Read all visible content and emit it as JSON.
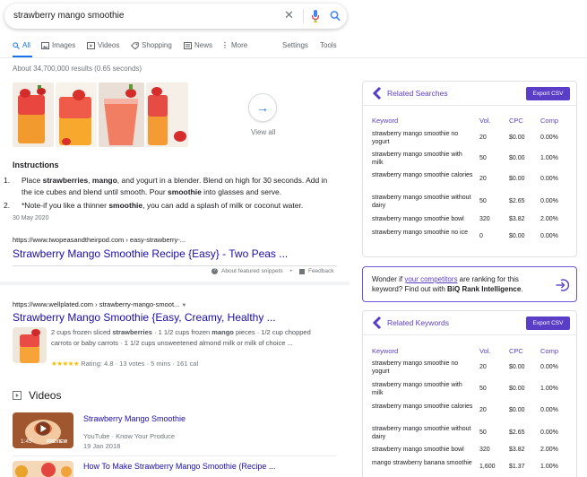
{
  "search": {
    "query": "strawberry mango smoothie",
    "clear_icon": "close-icon",
    "voice_icon": "mic-icon",
    "search_icon": "search-icon"
  },
  "tabs": [
    {
      "label": "All",
      "icon": "search-icon",
      "active": true
    },
    {
      "label": "Images",
      "icon": "image-icon"
    },
    {
      "label": "Videos",
      "icon": "video-icon"
    },
    {
      "label": "Shopping",
      "icon": "tag-icon"
    },
    {
      "label": "News",
      "icon": "news-icon"
    },
    {
      "label": "More",
      "icon": "dots-icon"
    },
    {
      "label": "Settings"
    },
    {
      "label": "Tools"
    }
  ],
  "stats": "About 34,700,000 results (0.65 seconds)",
  "images": {
    "view_all": "View all"
  },
  "featured": {
    "heading": "Instructions",
    "steps": [
      {
        "n": "1.",
        "parts": [
          "Place ",
          "strawberries",
          ", ",
          "mango",
          ", and yogurt in a blender. Blend on high for 30 seconds. Add in the ice cubes and blend until smooth. Pour ",
          "smoothie",
          " into glasses and serve."
        ]
      },
      {
        "n": "2.",
        "parts": [
          "*Note-if you like a thinner ",
          "smoothie",
          ", you can add a splash of milk or coconut water."
        ]
      }
    ],
    "date": "30 May 2020",
    "url": "https://www.twopeasandtheirpod.com › easy-strawberry-...",
    "title": "Strawberry Mango Smoothie Recipe {Easy} - Two Peas ...",
    "about": "About featured snippets",
    "dot": "•",
    "feedback": "Feedback"
  },
  "result2": {
    "url": "https://www.wellplated.com › strawberry-mango-smoot...",
    "title": "Strawberry Mango Smoothie {Easy, Creamy, Healthy ...",
    "snippet_parts": [
      "2 cups frozen sliced ",
      "strawberries",
      " · 1 1/2 cups frozen ",
      "mango",
      " pieces · 1/2 cup chopped carrots or baby carrots · 1 1/2 cups unsweetened almond milk or milk of choice ..."
    ],
    "stars": "★★★★★",
    "rating_text": "Rating: 4.8 · 13 votes · 5 mins · 161 cal"
  },
  "videos": {
    "heading": "Videos",
    "items": [
      {
        "title": "Strawberry Mango Smoothie",
        "source": "YouTube · Know Your Produce",
        "date": "19 Jan 2018",
        "duration": "1:45",
        "badge": "PREVIEW"
      },
      {
        "title": "How To Make Strawberry Mango Smoothie (Recipe ..."
      }
    ]
  },
  "related_searches": {
    "title": "Related Searches",
    "export": "Export CSV",
    "headers": [
      "Keyword",
      "Vol.",
      "CPC",
      "Comp"
    ],
    "rows": [
      [
        "strawberry mango smoothie no yogurt",
        "20",
        "$0.00",
        "0.00%"
      ],
      [
        "strawberry mango smoothie with milk",
        "50",
        "$0.00",
        "1.00%"
      ],
      [
        "strawberry mango smoothie calories",
        "20",
        "$0.00",
        "0.00%"
      ],
      [
        "strawberry mango smoothie without dairy",
        "50",
        "$2.65",
        "0.00%"
      ],
      [
        "strawberry mango smoothie bowl",
        "320",
        "$3.82",
        "2.00%"
      ],
      [
        "strawberry mango smoothie no ice",
        "0",
        "$0.00",
        "0.00%"
      ]
    ]
  },
  "promo": {
    "pre": "Wonder if ",
    "link": "your competitors",
    "mid": " are ranking for this keyword? Find out with ",
    "bold": "BiQ Rank Intelligence",
    "post": "."
  },
  "related_keywords": {
    "title": "Related Keywords",
    "export": "Export CSV",
    "headers": [
      "Keyword",
      "Vol.",
      "CPC",
      "Comp"
    ],
    "rows": [
      [
        "strawberry mango smoothie no yogurt",
        "20",
        "$0.00",
        "0.00%"
      ],
      [
        "strawberry mango smoothie with milk",
        "50",
        "$0.00",
        "1.00%"
      ],
      [
        "strawberry mango smoothie calories",
        "20",
        "$0.00",
        "0.00%"
      ],
      [
        "strawberry mango smoothie without dairy",
        "50",
        "$2.65",
        "0.00%"
      ],
      [
        "strawberry mango smoothie bowl",
        "320",
        "$3.82",
        "2.00%"
      ],
      [
        "mango strawberry banana smoothie",
        "1,600",
        "$1.37",
        "1.00%"
      ]
    ]
  }
}
